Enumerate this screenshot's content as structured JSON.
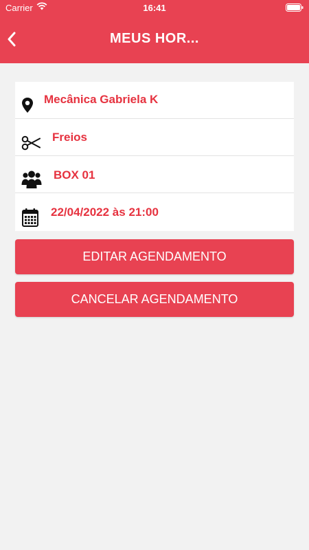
{
  "status_bar": {
    "carrier": "Carrier",
    "time": "16:41"
  },
  "header": {
    "title": "MEUS HOR...",
    "color": "#e84252"
  },
  "details": {
    "location": {
      "icon": "map-pin-icon",
      "label": "Mecânica Gabriela K"
    },
    "service": {
      "icon": "scissors-icon",
      "label": "Freios"
    },
    "box": {
      "icon": "group-icon",
      "label": "BOX 01"
    },
    "datetime": {
      "icon": "calendar-icon",
      "label": "22/04/2022 às 21:00"
    }
  },
  "actions": {
    "edit_label": "EDITAR AGENDAMENTO",
    "cancel_label": "CANCELAR AGENDAMENTO"
  }
}
